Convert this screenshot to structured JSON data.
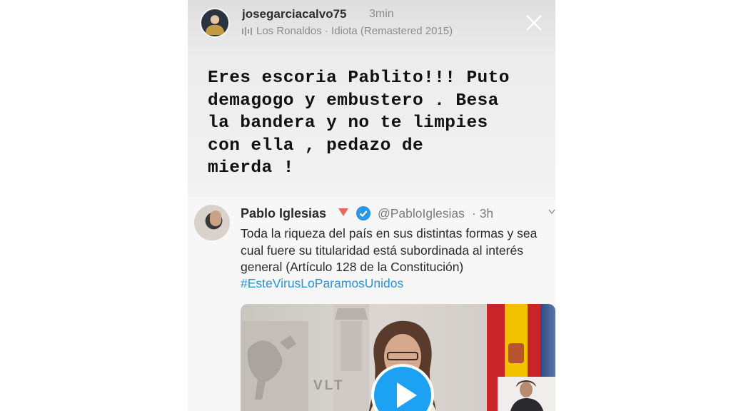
{
  "story": {
    "username": "josegarciacalvo75",
    "time_ago": "3min",
    "music": "Los Ronaldos · Idiota (Remastered 2015)",
    "text": "Eres escoria Pablito!!! Puto\ndemagogo y embustero . Besa\nla bandera y no te limpies\ncon ella , pedazo de\nmierda !",
    "icons": {
      "avatar": "user-avatar",
      "music": "music-bars-icon",
      "close": "close-icon"
    }
  },
  "tweet": {
    "name": "Pablo Iglesias",
    "handle": "@PabloIglesias",
    "time": "· 3h",
    "body": "Toda la riqueza del país en sus distintas formas y sea cual fuere su titularidad está subordinada al interés general (Artículo 128 de la Constitución)",
    "hashtag": "#EsteVirusLoParamosUnidos",
    "media_text": "VLT",
    "icons": {
      "party": "rose-icon",
      "verified": "verified-badge-icon",
      "more": "chevron-down-icon",
      "play": "play-icon"
    },
    "colors": {
      "link": "#2a93d9",
      "play": "#1da1f2",
      "verified": "#2a98e8"
    }
  }
}
